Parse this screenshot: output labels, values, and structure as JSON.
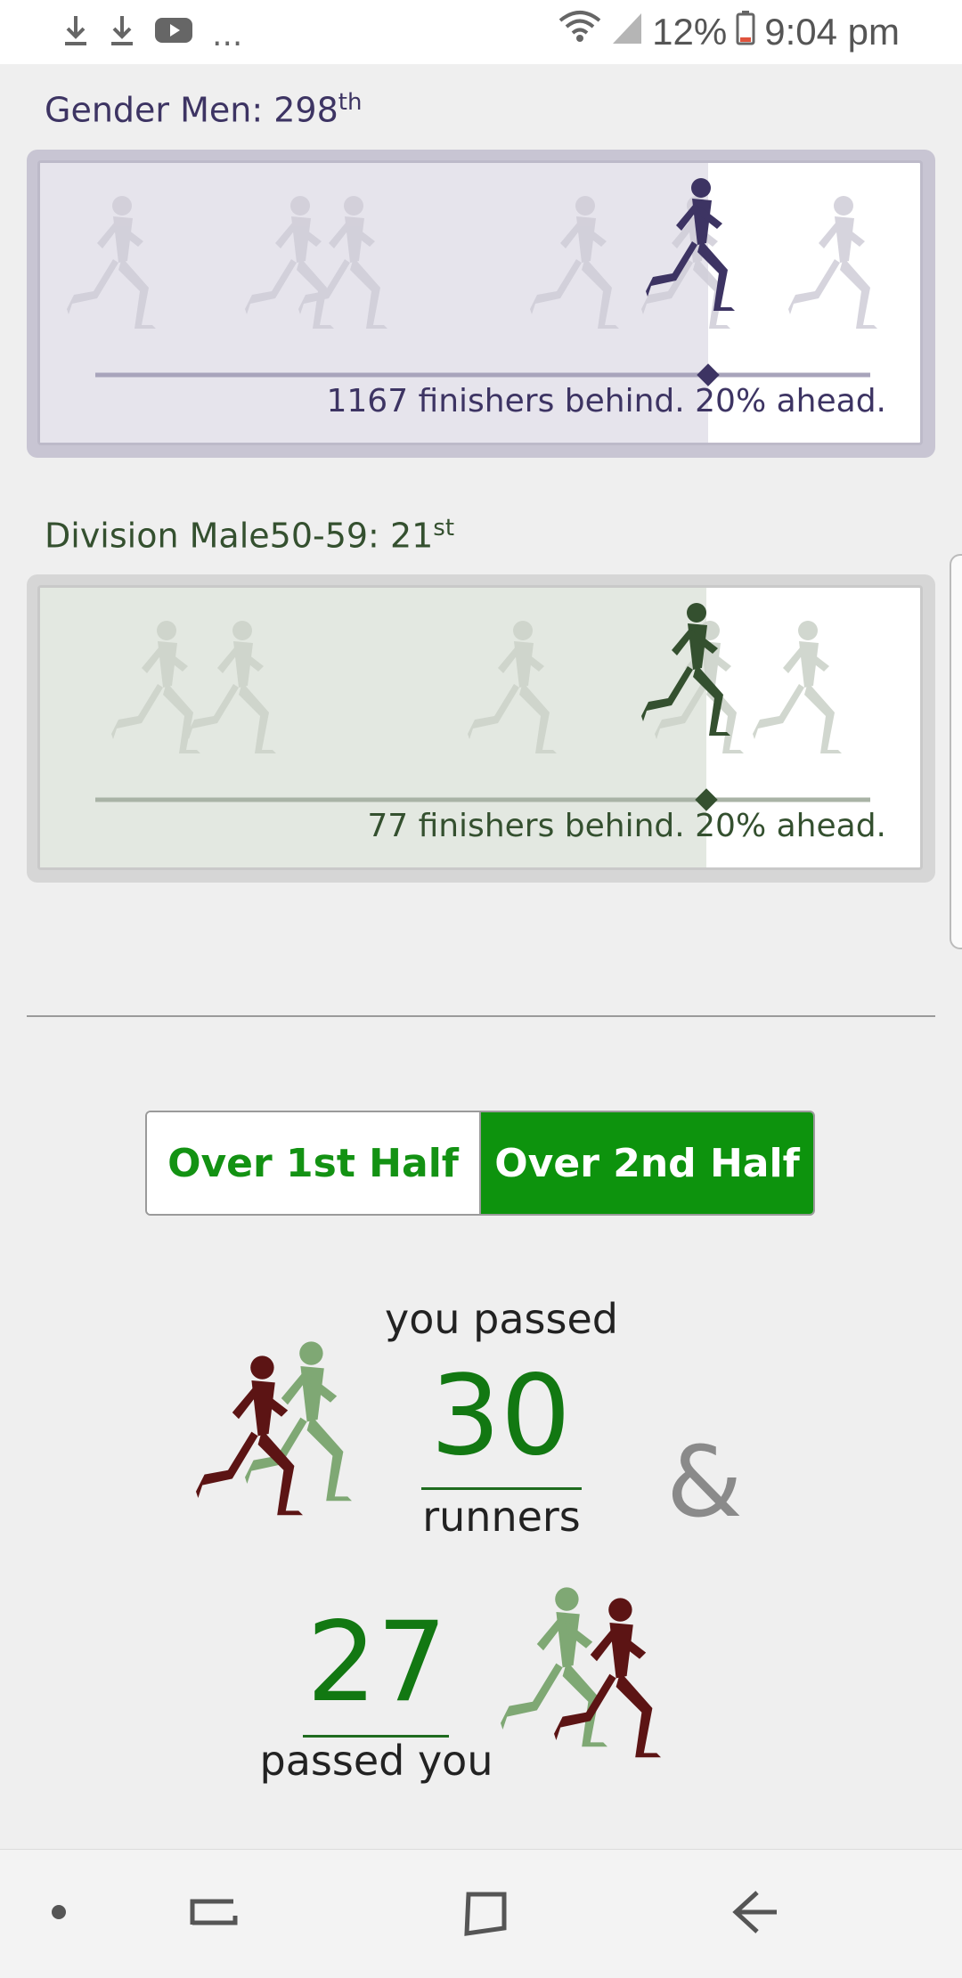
{
  "status_bar": {
    "left_icons": [
      "download-icon",
      "download-icon",
      "youtube-icon",
      "more-notifications-icon"
    ],
    "more_text": "...",
    "battery": "12%",
    "time": "9:04 pm"
  },
  "gender_rank": {
    "label": "Gender Men: 298",
    "suffix": "th",
    "summary": "1167 finishers behind. 20% ahead.",
    "percent_ahead": 20,
    "color": "#3d3463",
    "bg_color": "#e6e4ec",
    "frame_color": "#c8c5d3"
  },
  "division_rank": {
    "label": "Division Male50-59: 21",
    "suffix": "st",
    "summary": "77 finishers behind. 20% ahead.",
    "percent_ahead": 20,
    "color": "#34502f",
    "bg_color": "#e3e8e1",
    "frame_color": "#d6d6d6"
  },
  "toggle": {
    "first_half": "Over 1st Half",
    "second_half": "Over 2nd Half",
    "selected": "Over 2nd Half"
  },
  "passing": {
    "you_passed_label": "you passed",
    "you_passed_count": "30",
    "runners_label": "runners",
    "ampersand": "&",
    "passed_you_count": "27",
    "passed_you_label": "passed you"
  },
  "nav": {
    "items": [
      "dot-icon",
      "recent-apps-icon",
      "home-icon",
      "back-icon"
    ]
  }
}
